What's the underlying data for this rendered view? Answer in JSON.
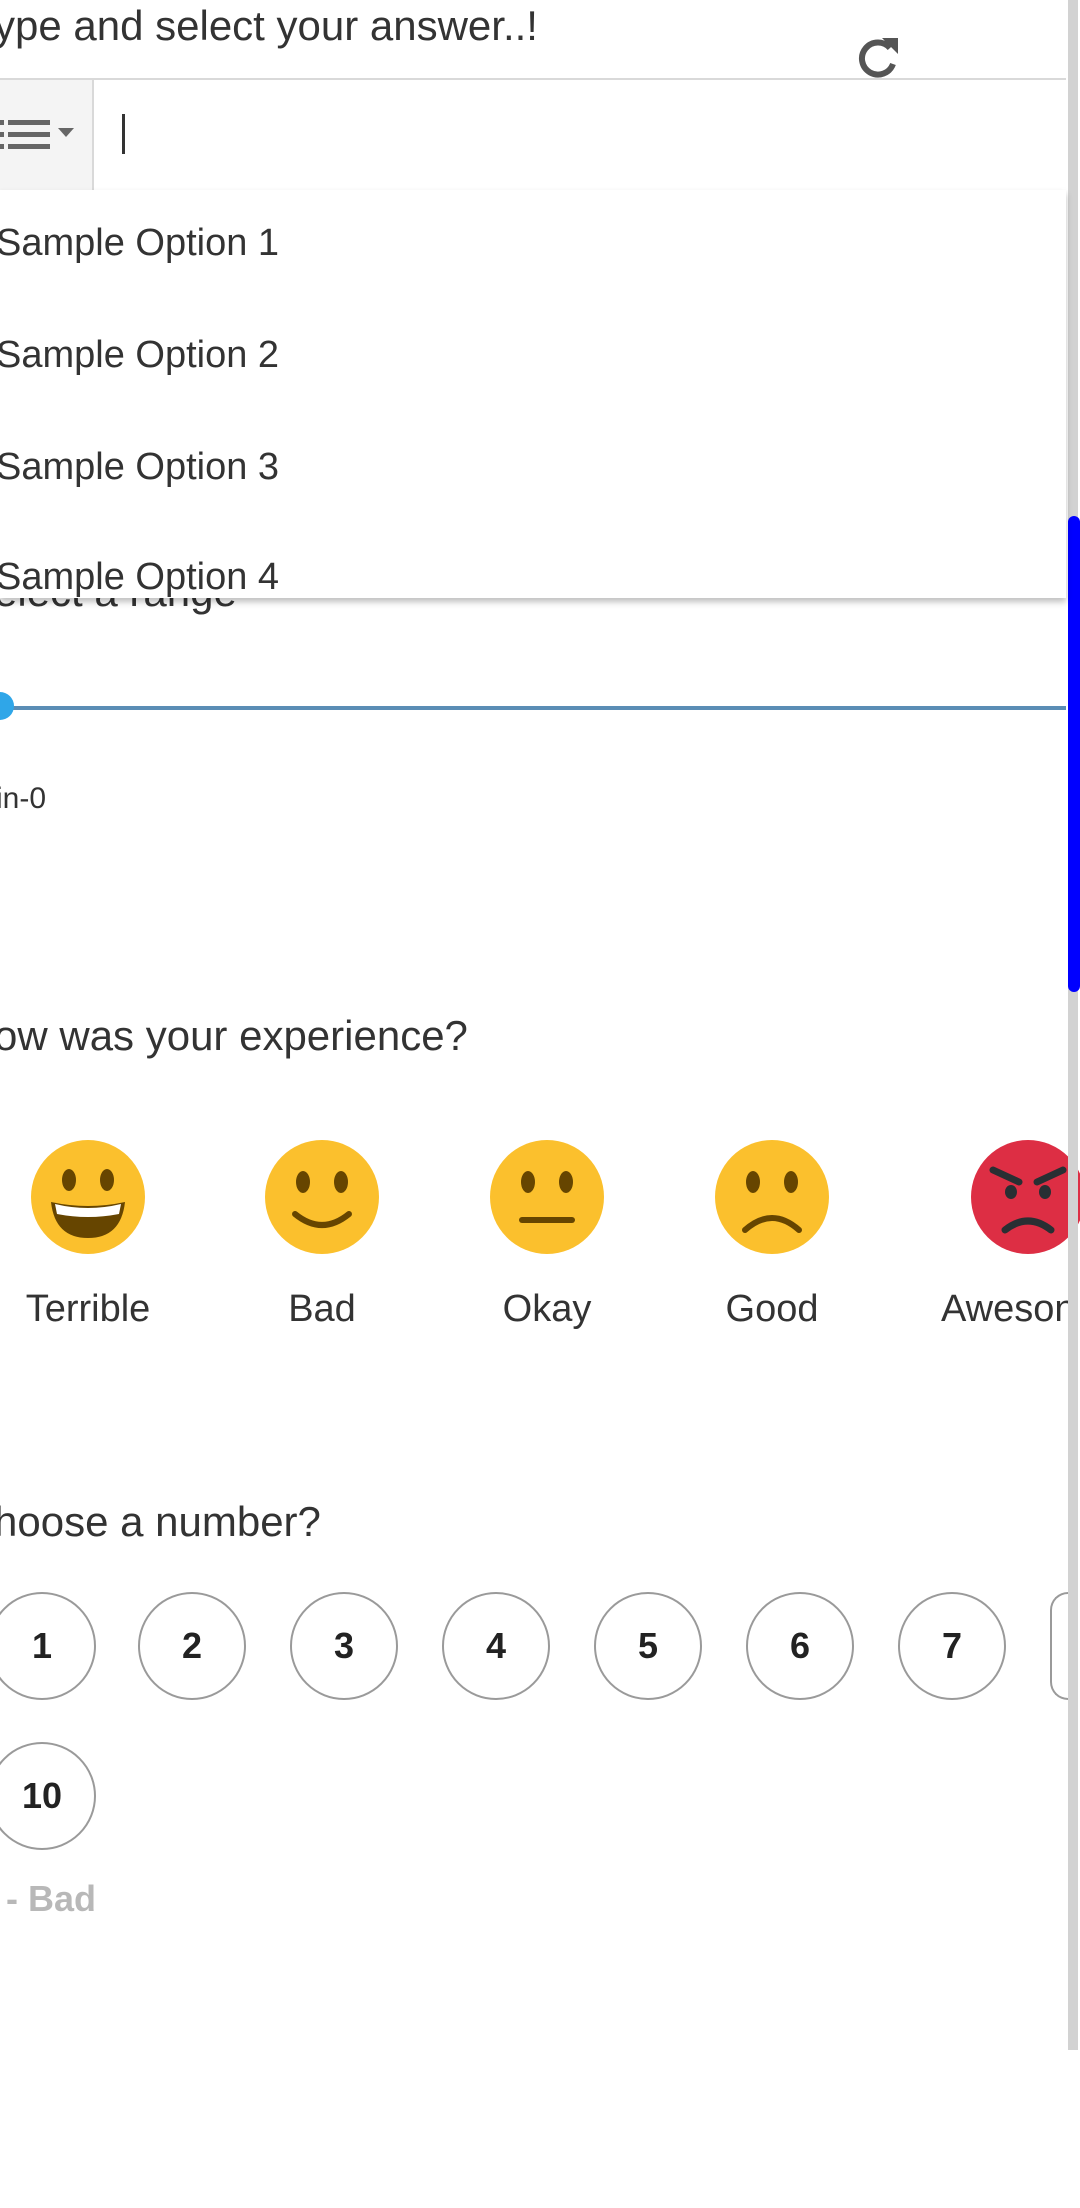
{
  "typeahead": {
    "question": "ype and select your answer..!",
    "input_value": "",
    "options": [
      "Sample Option 1",
      "Sample Option 2",
      "Sample Option 3",
      "Sample Option 4"
    ]
  },
  "range": {
    "question": "elect a range",
    "min_label": "in-0",
    "value": 0
  },
  "experience": {
    "question": "ow was your experience?",
    "options": [
      {
        "label": "Terrible",
        "icon": "grinning-face-icon"
      },
      {
        "label": "Bad",
        "icon": "slightly-smiling-face-icon"
      },
      {
        "label": "Okay",
        "icon": "neutral-face-icon"
      },
      {
        "label": "Good",
        "icon": "frowning-face-icon"
      },
      {
        "label": "Aweson",
        "icon": "angry-face-icon"
      }
    ]
  },
  "number": {
    "question": "hoose a number?",
    "numbers": [
      "1",
      "2",
      "3",
      "4",
      "5",
      "6",
      "7",
      "10"
    ],
    "legend": "- Bad"
  },
  "colors": {
    "emoji_yellow": "#fbc02d",
    "emoji_red": "#dd2e44",
    "scroll_thumb": "#0000ff",
    "slider_track": "#5a8db5"
  }
}
